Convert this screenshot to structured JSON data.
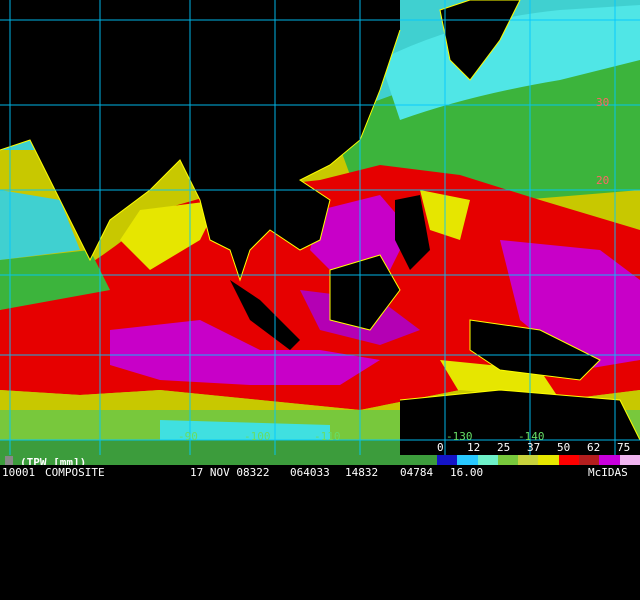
{
  "colorbar": {
    "colors": [
      "#1414c8",
      "#28c8ff",
      "#6ef0c8",
      "#78c83c",
      "#c8d23c",
      "#e6e600",
      "#ff0000",
      "#b41e1e",
      "#c800dc",
      "#f0b4f0"
    ],
    "ticks": [
      "0",
      "12",
      "25",
      "37",
      "50",
      "62",
      "75"
    ]
  },
  "legend": {
    "label": "(TPW [mm])"
  },
  "status": {
    "id": "10001",
    "product": "COMPOSITE",
    "date": "17 NOV 08322",
    "time": "064033",
    "seq": "14832",
    "code": "04784",
    "res": "16.00",
    "logo": "McIDAS"
  },
  "grid": {
    "lat_labels": [
      "30",
      "20"
    ],
    "lon_labels": [
      "-90",
      "-100",
      "-110",
      "-130",
      "-140"
    ]
  },
  "palette": {
    "land": "#000000",
    "coast": "#ffff00",
    "grid": "#00c8ff",
    "lat_label": "#ff6666",
    "lon_label": "#66dd66"
  }
}
